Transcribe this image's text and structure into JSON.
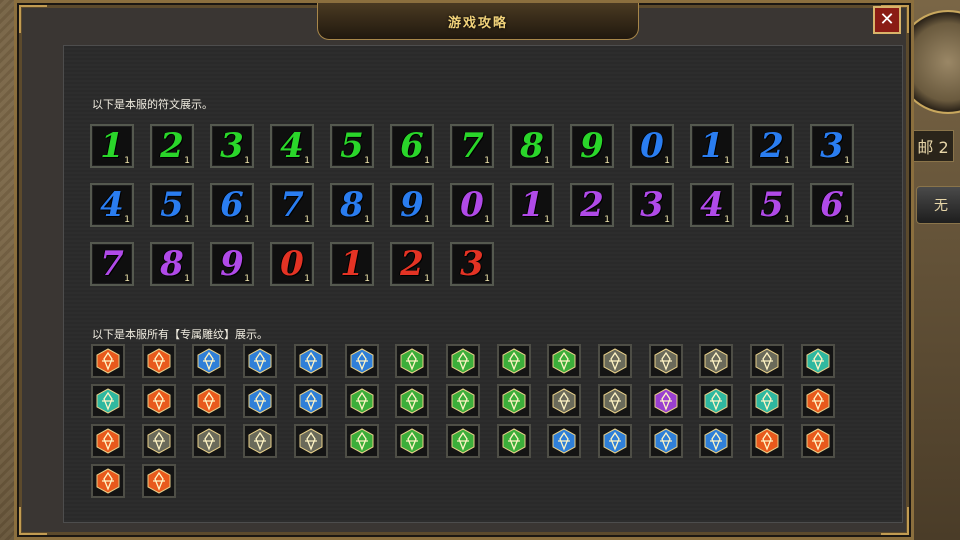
{
  "window": {
    "title": "游戏攻略",
    "close_label": "✕"
  },
  "hud": {
    "mail_label": "邮 2",
    "side_button_label": "无"
  },
  "sections": {
    "rune_heading": "以下是本服的符文展示。",
    "emblem_heading": "以下是本服所有【专属雕纹】展示。"
  },
  "colors": {
    "green": "#2ad62a",
    "blue": "#2a7df0",
    "purple": "#b04ae8",
    "red": "#e43324"
  },
  "runes": [
    {
      "digit": "1",
      "color": "green",
      "count": "1"
    },
    {
      "digit": "2",
      "color": "green",
      "count": "1"
    },
    {
      "digit": "3",
      "color": "green",
      "count": "1"
    },
    {
      "digit": "4",
      "color": "green",
      "count": "1"
    },
    {
      "digit": "5",
      "color": "green",
      "count": "1"
    },
    {
      "digit": "6",
      "color": "green",
      "count": "1"
    },
    {
      "digit": "7",
      "color": "green",
      "count": "1"
    },
    {
      "digit": "8",
      "color": "green",
      "count": "1"
    },
    {
      "digit": "9",
      "color": "green",
      "count": "1"
    },
    {
      "digit": "0",
      "color": "blue",
      "count": "1"
    },
    {
      "digit": "1",
      "color": "blue",
      "count": "1"
    },
    {
      "digit": "2",
      "color": "blue",
      "count": "1"
    },
    {
      "digit": "3",
      "color": "blue",
      "count": "1"
    },
    {
      "digit": "4",
      "color": "blue",
      "count": "1"
    },
    {
      "digit": "5",
      "color": "blue",
      "count": "1"
    },
    {
      "digit": "6",
      "color": "blue",
      "count": "1"
    },
    {
      "digit": "7",
      "color": "blue",
      "count": "1"
    },
    {
      "digit": "8",
      "color": "blue",
      "count": "1"
    },
    {
      "digit": "9",
      "color": "blue",
      "count": "1"
    },
    {
      "digit": "0",
      "color": "purple",
      "count": "1"
    },
    {
      "digit": "1",
      "color": "purple",
      "count": "1"
    },
    {
      "digit": "2",
      "color": "purple",
      "count": "1"
    },
    {
      "digit": "3",
      "color": "purple",
      "count": "1"
    },
    {
      "digit": "4",
      "color": "purple",
      "count": "1"
    },
    {
      "digit": "5",
      "color": "purple",
      "count": "1"
    },
    {
      "digit": "6",
      "color": "purple",
      "count": "1"
    },
    {
      "digit": "7",
      "color": "purple",
      "count": "1"
    },
    {
      "digit": "8",
      "color": "purple",
      "count": "1"
    },
    {
      "digit": "9",
      "color": "purple",
      "count": "1"
    },
    {
      "digit": "0",
      "color": "red",
      "count": "1"
    },
    {
      "digit": "1",
      "color": "red",
      "count": "1"
    },
    {
      "digit": "2",
      "color": "red",
      "count": "1"
    },
    {
      "digit": "3",
      "color": "red",
      "count": "1"
    }
  ],
  "emblems": [
    {
      "icon": "fire-emblem-icon",
      "color": "#e8591c"
    },
    {
      "icon": "fire-emblem-icon",
      "color": "#e8591c"
    },
    {
      "icon": "blue-emblem-icon",
      "color": "#2f7fd8"
    },
    {
      "icon": "blue-emblem-icon",
      "color": "#2f7fd8"
    },
    {
      "icon": "blue-emblem-icon",
      "color": "#2f7fd8"
    },
    {
      "icon": "blue-emblem-icon",
      "color": "#2f7fd8"
    },
    {
      "icon": "green-emblem-icon",
      "color": "#3cae3a"
    },
    {
      "icon": "green-emblem-icon",
      "color": "#3cae3a"
    },
    {
      "icon": "green-emblem-icon",
      "color": "#3cae3a"
    },
    {
      "icon": "green-emblem-icon",
      "color": "#3cae3a"
    },
    {
      "icon": "gray-emblem-icon",
      "color": "#6a6a5a"
    },
    {
      "icon": "gray-emblem-icon",
      "color": "#6a6a5a"
    },
    {
      "icon": "gray-emblem-icon",
      "color": "#6a6a5a"
    },
    {
      "icon": "gray-emblem-icon",
      "color": "#6a6a5a"
    },
    {
      "icon": "teal-emblem-icon",
      "color": "#2fb8a0"
    },
    {
      "icon": "teal-emblem-icon",
      "color": "#2fb8a0"
    },
    {
      "icon": "fire-emblem-icon",
      "color": "#e8591c"
    },
    {
      "icon": "fire-emblem-icon",
      "color": "#e8591c"
    },
    {
      "icon": "blue-emblem-icon",
      "color": "#2f7fd8"
    },
    {
      "icon": "blue-emblem-icon",
      "color": "#2f7fd8"
    },
    {
      "icon": "green-emblem-icon",
      "color": "#3cae3a"
    },
    {
      "icon": "green-emblem-icon",
      "color": "#3cae3a"
    },
    {
      "icon": "green-emblem-icon",
      "color": "#3cae3a"
    },
    {
      "icon": "green-emblem-icon",
      "color": "#3cae3a"
    },
    {
      "icon": "gray-emblem-icon",
      "color": "#6a6a5a"
    },
    {
      "icon": "gray-emblem-icon",
      "color": "#6a6a5a"
    },
    {
      "icon": "purple-emblem-icon",
      "color": "#9a3fd0"
    },
    {
      "icon": "teal-emblem-icon",
      "color": "#2fb8a0"
    },
    {
      "icon": "teal-emblem-icon",
      "color": "#2fb8a0"
    },
    {
      "icon": "fire-emblem-icon",
      "color": "#e8591c"
    },
    {
      "icon": "fire-emblem-icon",
      "color": "#e8591c"
    },
    {
      "icon": "gray-emblem-icon",
      "color": "#6a6a5a"
    },
    {
      "icon": "gray-emblem-icon",
      "color": "#6a6a5a"
    },
    {
      "icon": "gray-emblem-icon",
      "color": "#6a6a5a"
    },
    {
      "icon": "gray-emblem-icon",
      "color": "#6a6a5a"
    },
    {
      "icon": "green-emblem-icon",
      "color": "#3cae3a"
    },
    {
      "icon": "green-emblem-icon",
      "color": "#3cae3a"
    },
    {
      "icon": "green-emblem-icon",
      "color": "#3cae3a"
    },
    {
      "icon": "green-emblem-icon",
      "color": "#3cae3a"
    },
    {
      "icon": "blue-emblem-icon",
      "color": "#2f7fd8"
    },
    {
      "icon": "blue-emblem-icon",
      "color": "#2f7fd8"
    },
    {
      "icon": "blue-emblem-icon",
      "color": "#2f7fd8"
    },
    {
      "icon": "blue-emblem-icon",
      "color": "#2f7fd8"
    },
    {
      "icon": "fire-emblem-icon",
      "color": "#e8591c"
    },
    {
      "icon": "fire-emblem-icon",
      "color": "#e8591c"
    },
    {
      "icon": "fire-emblem-icon",
      "color": "#e8591c"
    },
    {
      "icon": "fire-emblem-icon",
      "color": "#e8591c"
    }
  ]
}
